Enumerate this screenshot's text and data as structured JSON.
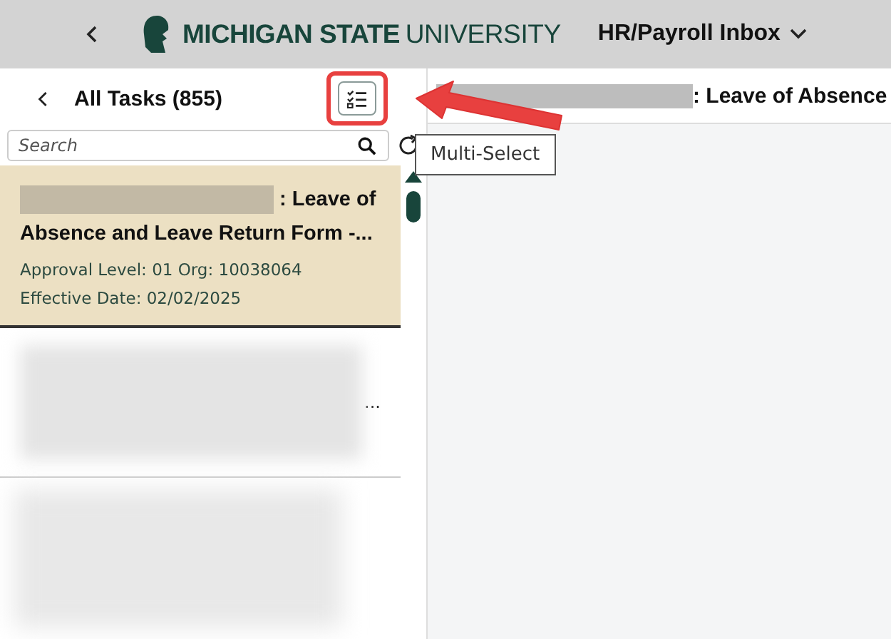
{
  "header": {
    "university_bold": "MICHIGAN STATE",
    "university_light": "UNIVERSITY",
    "inbox_title": "HR/Payroll Inbox"
  },
  "task_list": {
    "title": "All Tasks (855)",
    "search": {
      "placeholder": "Search"
    },
    "tasks": [
      {
        "title": ": Leave of",
        "title_cont": "Absence and Leave Return Form -...",
        "approval": "Approval Level: 01 Org: 10038064",
        "effective": "Effective Date: 02/02/2025",
        "selected": true
      },
      {
        "title": "...",
        "selected": false
      }
    ]
  },
  "tooltip": "Multi-Select",
  "detail": {
    "title": ": Leave of Absence"
  }
}
